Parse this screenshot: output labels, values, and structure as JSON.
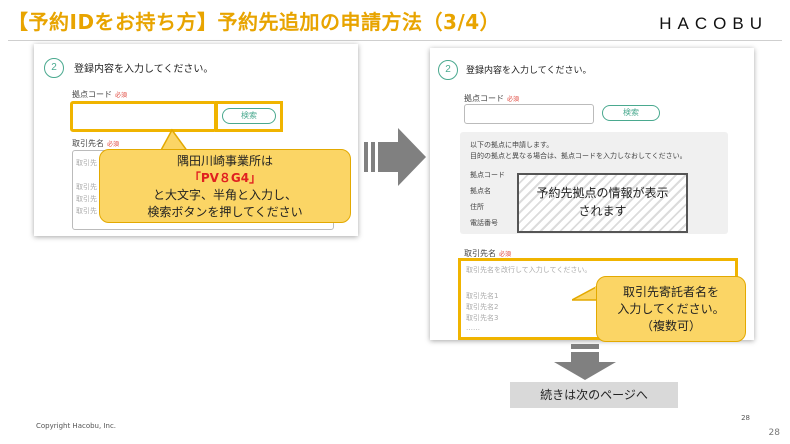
{
  "slide": {
    "title": "【予約IDをお持ち方】予約先追加の申請方法（3/4）",
    "logo": "HACOBU"
  },
  "left_screen": {
    "step_number": "2",
    "step_title": "登録内容を入力してください。",
    "code_label": "拠点コード",
    "required_badge": "必須",
    "search_button": "検索",
    "partner_label": "取引先名",
    "faint_lines": [
      "取引先",
      "取引先",
      "取引先",
      "取引先"
    ]
  },
  "left_callout": {
    "line1": "隅田川崎事業所は",
    "code": "「PV８G4」",
    "line3": "と大文字、半角と入力し、",
    "line4": "検索ボタンを押してください"
  },
  "right_screen": {
    "step_number": "2",
    "step_title": "登録内容を入力してください。",
    "code_label": "拠点コード",
    "required_badge": "必須",
    "search_button": "検索",
    "info_line1": "以下の拠点に申請します。",
    "info_line2": "目的の拠点と異なる場合は、拠点コードを入力しなおしてください。",
    "info_fields": [
      "拠点コード",
      "拠点名",
      "住所",
      "電話番号"
    ],
    "info_placeholder_line1": "予約先拠点の情報が表示",
    "info_placeholder_line2": "されます",
    "partner_label": "取引先名",
    "partner_hint": "取引先名を改行して入力してください。",
    "partner_lines": [
      "取引先名1",
      "取引先名2",
      "取引先名3"
    ],
    "partner_more": "……"
  },
  "right_callout": {
    "line1": "取引先寄託者名を",
    "line2": "入力してください。",
    "line3": "（複数可）"
  },
  "next_page": "続きは次のページへ",
  "footer": {
    "copyright": "Copyright Hacobu, Inc.",
    "page_small": "28",
    "page": "28"
  },
  "colors": {
    "title": "#e8a400",
    "highlight": "#f0b400",
    "callout": "#fbd565",
    "accent": "#4aa98f",
    "arrow": "#808080"
  }
}
